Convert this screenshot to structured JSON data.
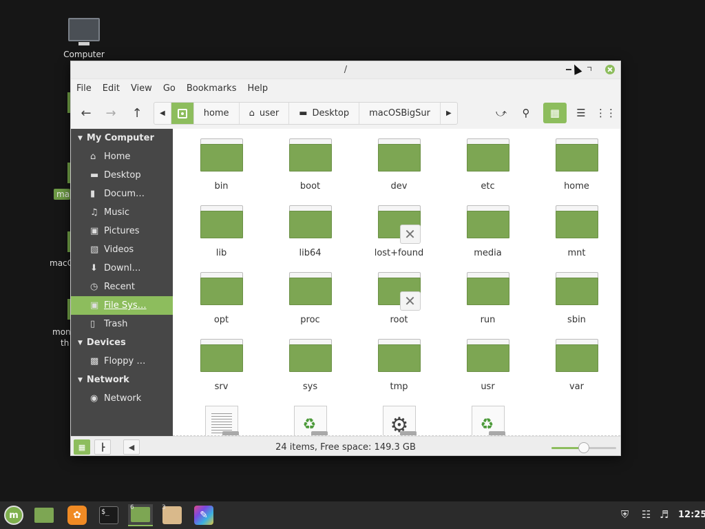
{
  "desktop": {
    "computer_label": "Computer",
    "partial_labels": [
      "ma",
      "macC",
      "mon",
      "th"
    ]
  },
  "window": {
    "title": "/",
    "menu": [
      "File",
      "Edit",
      "View",
      "Go",
      "Bookmarks",
      "Help"
    ],
    "breadcrumbs": [
      "home",
      "user",
      "Desktop",
      "macOSBigSur"
    ]
  },
  "sidebar": {
    "my_computer": "My Computer",
    "items": [
      "Home",
      "Desktop",
      "Docum…",
      "Music",
      "Pictures",
      "Videos",
      "Downl…",
      "Recent",
      "File Sys…",
      "Trash"
    ],
    "devices": "Devices",
    "device_items": [
      "Floppy …"
    ],
    "network": "Network",
    "network_items": [
      "Network"
    ]
  },
  "files": [
    {
      "name": "bin",
      "restricted": false
    },
    {
      "name": "boot",
      "restricted": false
    },
    {
      "name": "dev",
      "restricted": false
    },
    {
      "name": "etc",
      "restricted": false
    },
    {
      "name": "home",
      "restricted": false
    },
    {
      "name": "lib",
      "restricted": false
    },
    {
      "name": "lib64",
      "restricted": false
    },
    {
      "name": "lost+found",
      "restricted": true
    },
    {
      "name": "media",
      "restricted": false
    },
    {
      "name": "mnt",
      "restricted": false
    },
    {
      "name": "opt",
      "restricted": false
    },
    {
      "name": "proc",
      "restricted": false
    },
    {
      "name": "root",
      "restricted": true
    },
    {
      "name": "run",
      "restricted": false
    },
    {
      "name": "sbin",
      "restricted": false
    },
    {
      "name": "srv",
      "restricted": false
    },
    {
      "name": "sys",
      "restricted": false
    },
    {
      "name": "tmp",
      "restricted": false
    },
    {
      "name": "usr",
      "restricted": false
    },
    {
      "name": "var",
      "restricted": false
    }
  ],
  "partial_files": [
    "text-document-link-icon",
    "recycle-link-icon",
    "gear-link-icon",
    "recycle-link-icon"
  ],
  "status": {
    "text": "24 items, Free space: 149.3 GB",
    "zoom_fraction": 0.5
  },
  "taskbar": {
    "badge_files": "6",
    "badge_box": "3",
    "clock": "12:25"
  },
  "colors": {
    "accent": "#8dbd5d",
    "folder": "#7da653",
    "sidebar_bg": "#474747"
  }
}
